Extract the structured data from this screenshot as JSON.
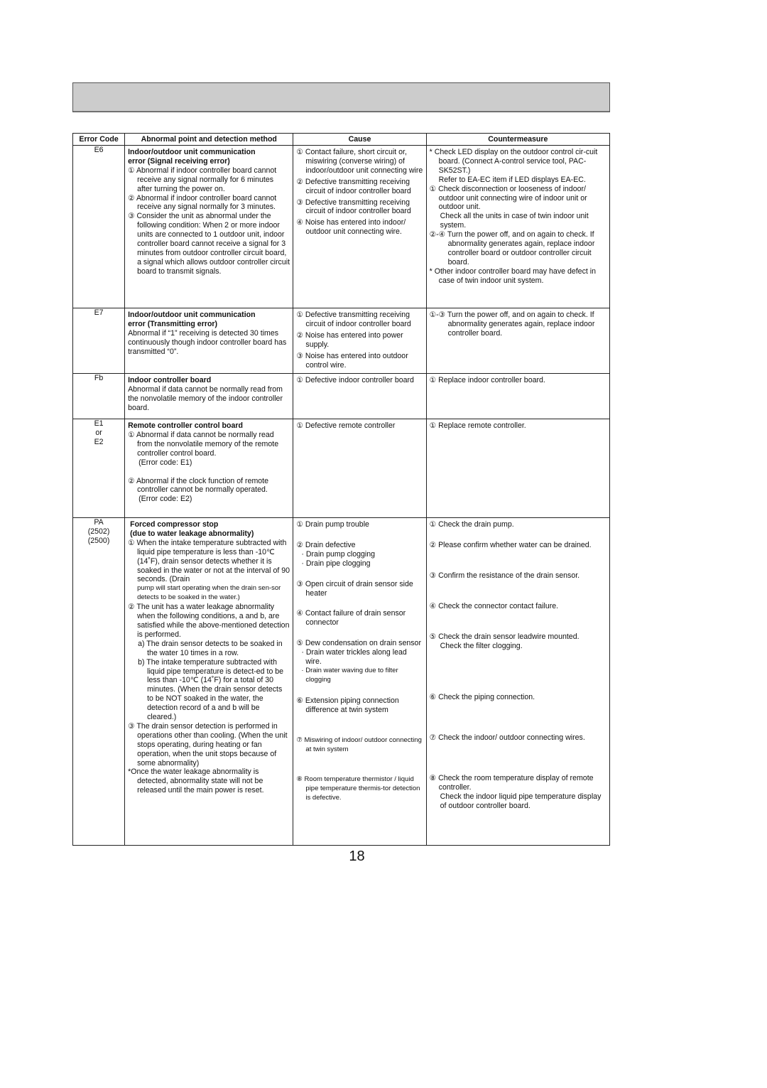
{
  "page": {
    "number": "18"
  },
  "table": {
    "headers": {
      "code": "Error Code",
      "abnormal": "Abnormal point and detection method",
      "cause": "Cause",
      "countermeasure": "Countermeasure"
    },
    "rows": [
      {
        "code": [
          "E6"
        ],
        "abnormal": {
          "title": [
            "Indoor/outdoor unit communication",
            "error (Signal receiving error)"
          ],
          "lines": [
            "① Abnormal if indoor controller board cannot receive any signal normally for 6 minutes after turning the power on.",
            "② Abnormal if indoor controller board cannot receive any signal normally for 3 minutes.",
            "③ Consider the unit as abnormal under the following condition: When 2 or more indoor units are connected to 1 outdoor unit, indoor controller board cannot receive a signal for 3 minutes from outdoor controller circuit board, a signal which allows outdoor controller circuit board to transmit signals."
          ]
        },
        "cause": [
          "① Contact failure, short circuit or, miswiring (converse wiring) of indoor/outdoor unit connecting wire",
          "② Defective transmitting receiving circuit of indoor controller board",
          "③ Defective transmitting receiving circuit of indoor controller board",
          "④ Noise has entered into indoor/ outdoor unit connecting wire."
        ],
        "countermeasure": [
          "* Check LED display on the outdoor control cir-cuit board. (Connect A-control service tool, PAC-SK52ST.)",
          "Refer to EA-EC item if LED displays EA-EC.",
          "① Check disconnection or looseness of indoor/ outdoor unit connecting wire of indoor unit or outdoor unit.",
          "Check all the units in case of twin indoor unit system.",
          "②-④ Turn the power off, and on again to check. If abnormality generates again, replace indoor controller board or outdoor controller circuit board.",
          "* Other indoor controller board may have defect in case of twin indoor unit system."
        ]
      },
      {
        "code": [
          "E7"
        ],
        "abnormal": {
          "title": [
            "Indoor/outdoor unit communication",
            "error (Transmitting error)"
          ],
          "lines": [
            "Abnormal if “1” receiving is detected 30 times continuously though indoor controller board has transmitted “0”."
          ]
        },
        "cause": [
          "① Defective transmitting receiving circuit of indoor controller board",
          "② Noise has entered into power supply.",
          "③ Noise has entered into outdoor control wire."
        ],
        "countermeasure": [
          "①-③ Turn the power off, and on again to check. If abnormality generates again, replace indoor controller board."
        ]
      },
      {
        "code": [
          "Fb"
        ],
        "abnormal": {
          "title": [
            "Indoor controller board"
          ],
          "lines": [
            "Abnormal if data cannot be normally read from the nonvolatile memory of the indoor controller board."
          ]
        },
        "cause": [
          "① Defective indoor controller board"
        ],
        "countermeasure": [
          "① Replace indoor controller board."
        ]
      },
      {
        "code": [
          "E1",
          "or",
          "E2"
        ],
        "abnormal": {
          "title": [
            "Remote controller control board"
          ],
          "lines": [
            "① Abnormal if data cannot be normally read from the nonvolatile memory of the remote controller control board.",
            "(Error code: E1)",
            "② Abnormal if the clock function of remote controller cannot be normally operated.",
            "(Error code: E2)"
          ]
        },
        "cause": [
          "① Defective remote controller"
        ],
        "countermeasure": [
          "① Replace remote controller."
        ]
      },
      {
        "code": [
          "PA",
          "(2502)",
          "(2500)"
        ],
        "abnormal": {
          "title": [
            "Forced compressor stop",
            "(due to water leakage abnormality)"
          ],
          "lines": [
            "① When the intake temperature subtracted with liquid pipe temperature is less than -10℃ (14˚F), drain sensor detects whether it is soaked in the water or not at the interval of 90 seconds. (Drain",
            "pump will start operating when the drain sen-sor detects to be soaked in the water.)",
            "② The unit has a water leakage abnormality when the following conditions, a and b, are satisfied while the above-mentioned detection is performed.",
            "a) The drain sensor detects to be soaked in the water 10 times in a row.",
            "b) The intake temperature subtracted with liquid pipe temperature is detect-ed to be less than -10℃ (14˚F) for a total of 30 minutes. (When the drain sensor detects to be NOT soaked in the water, the detection record of a and b will be cleared.)",
            "③ The drain sensor detection is performed in operations other than cooling. (When the unit stops operating, during heating or fan operation, when the unit stops because of some abnormality)",
            "*Once the water leakage abnormality is detected, abnormality state will not be released until the main power is reset."
          ]
        },
        "cause": [
          "① Drain pump trouble",
          "② Drain defective",
          "· Drain pump clogging",
          "· Drain pipe clogging",
          "③ Open circuit of drain sensor side heater",
          "④ Contact failure of drain sensor connector",
          "⑤ Dew condensation on drain sensor",
          "· Drain water trickles along lead wire.",
          "· Drain water waving due to filter clogging",
          "⑥ Extension piping connection difference at twin system",
          "⑦ Miswiring of indoor/ outdoor connecting at twin system",
          "⑧ Room temperature thermistor / liquid pipe temperature thermis-tor detection is defective."
        ],
        "countermeasure": [
          "① Check the drain pump.",
          "② Please confirm whether water can be drained.",
          "③ Confirm the resistance of the drain sensor.",
          "④ Check the connector contact failure.",
          "⑤ Check the drain sensor leadwire mounted.",
          "Check the filter clogging.",
          "⑥ Check the piping connection.",
          "⑦ Check the indoor/ outdoor connecting wires.",
          "⑧ Check the room temperature display of remote controller.",
          "Check the indoor liquid pipe temperature display of outdoor controller board."
        ]
      }
    ]
  }
}
